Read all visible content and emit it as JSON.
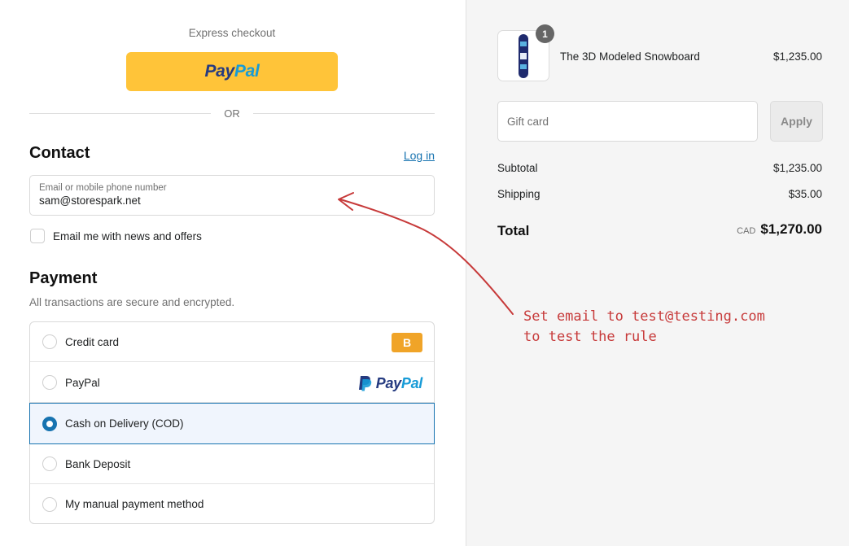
{
  "express": {
    "title": "Express checkout",
    "paypal_left": "Pay",
    "paypal_right": "Pal",
    "or_text": "OR"
  },
  "contact": {
    "title": "Contact",
    "login_link": "Log in",
    "email_label": "Email or mobile phone number",
    "email_value": "sam@storespark.net",
    "newsletter_label": "Email me with news and offers",
    "newsletter_checked": false
  },
  "payment": {
    "title": "Payment",
    "subtitle": "All transactions are secure and encrypted.",
    "methods": [
      {
        "label": "Credit card",
        "badge": "B",
        "selected": false
      },
      {
        "label": "PayPal",
        "logo_left": "Pay",
        "logo_right": "Pal",
        "selected": false
      },
      {
        "label": "Cash on Delivery (COD)",
        "selected": true
      },
      {
        "label": "Bank Deposit",
        "selected": false
      },
      {
        "label": "My manual payment method",
        "selected": false
      }
    ]
  },
  "order": {
    "item": {
      "name": "The 3D Modeled Snowboard",
      "price": "$1,235.00",
      "quantity": "1",
      "thumbnail_icon": "snowboard-icon"
    },
    "gift_card": {
      "placeholder": "Gift card",
      "apply_label": "Apply"
    },
    "subtotal_label": "Subtotal",
    "subtotal_value": "$1,235.00",
    "shipping_label": "Shipping",
    "shipping_value": "$35.00",
    "total_label": "Total",
    "currency": "CAD",
    "total_value": "$1,270.00"
  },
  "annotation": {
    "text": "Set email to test@testing.com\nto test the rule",
    "color": "#c73a3a"
  },
  "colors": {
    "accent": "#1773b0",
    "paypal_yellow": "#ffc439",
    "summary_bg": "#f5f5f5"
  }
}
